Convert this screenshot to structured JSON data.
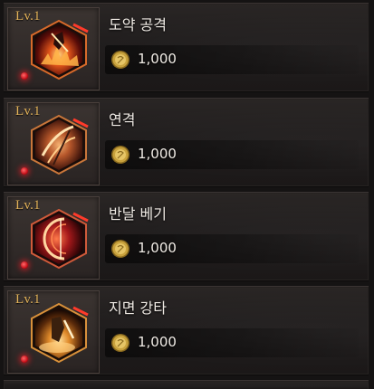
{
  "skills": [
    {
      "level": "Lv.1",
      "name": "도약 공격",
      "cost": "1,000",
      "icon": "leap-attack-icon"
    },
    {
      "level": "Lv.1",
      "name": "연격",
      "cost": "1,000",
      "icon": "combo-strike-icon"
    },
    {
      "level": "Lv.1",
      "name": "반달 베기",
      "cost": "1,000",
      "icon": "half-moon-slash-icon"
    },
    {
      "level": "Lv.1",
      "name": "지면 강타",
      "cost": "1,000",
      "icon": "ground-smash-icon"
    }
  ],
  "currency_icon": "gold-coin-icon",
  "colors": {
    "level_text": "#e3b35a",
    "indicator_red": "#c8101a",
    "name_text": "#f1ece6"
  }
}
